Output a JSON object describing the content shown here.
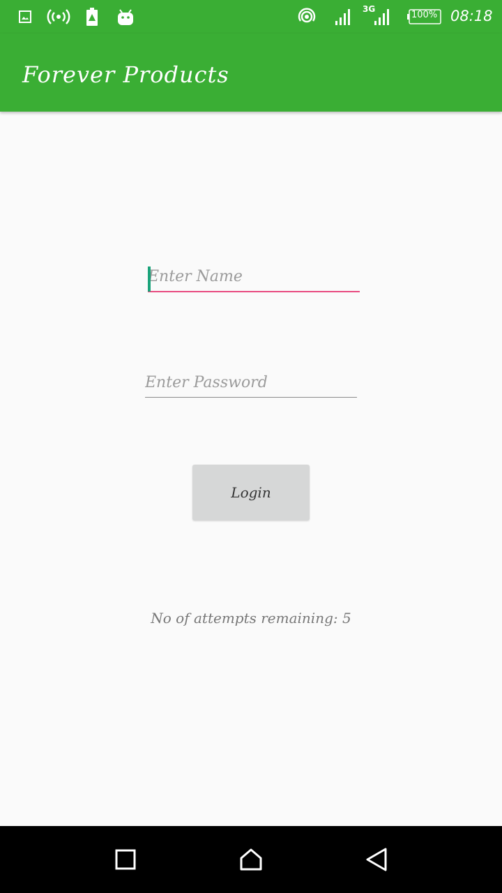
{
  "status_bar": {
    "battery": "100%",
    "time": "08:18",
    "network": "3G",
    "icons": [
      "gallery-icon",
      "hotspot-icon",
      "battery-alert-icon",
      "android-icon",
      "wifi-icon",
      "signal-icon",
      "signal-3g-icon",
      "battery-icon"
    ]
  },
  "app_bar": {
    "title": "Forever Products",
    "color": "#3aae34"
  },
  "form": {
    "name_placeholder": "Enter Name",
    "password_placeholder": "Enter Password",
    "login_label": "Login",
    "attempts_text": "No of attempts remaining: 5"
  },
  "nav_bar": {
    "icons": [
      "recents-icon",
      "home-icon",
      "back-icon"
    ]
  }
}
